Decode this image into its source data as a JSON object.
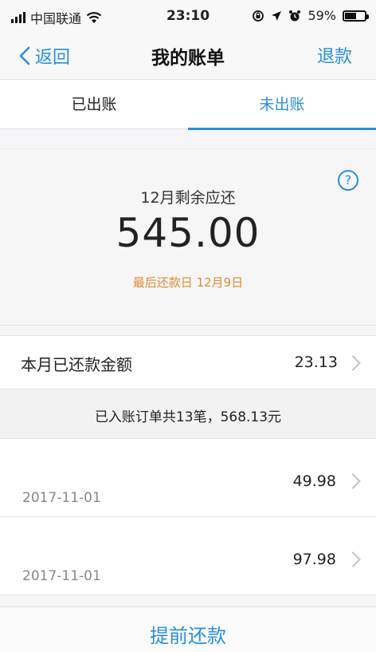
{
  "status_bar": {
    "carrier": "中国联通",
    "time": "23:10",
    "battery": "59%",
    "battery_level": 0.59,
    "icons": [
      "signal-icon",
      "wifi-icon",
      "rotation-lock-icon",
      "location-icon",
      "alarm-icon",
      "battery-icon"
    ]
  },
  "nav": {
    "back_label": "返回",
    "title": "我的账单",
    "right_label": "退款"
  },
  "tabs": [
    {
      "label": "已出账",
      "active": false
    },
    {
      "label": "未出账",
      "active": true
    }
  ],
  "summary": {
    "label": "12月剩余应还",
    "amount": "545.00",
    "due": "最后还款日 12月9日",
    "help_symbol": "?"
  },
  "repaid": {
    "label": "本月已还款金额",
    "value": "23.13"
  },
  "posted_summary": "已入账订单共13笔，568.13元",
  "bills": [
    {
      "amount": "49.98",
      "date": "2017-11-01"
    },
    {
      "amount": "97.98",
      "date": "2017-11-01"
    }
  ],
  "footer": {
    "button_label": "提前还款"
  },
  "colors": {
    "accent": "#2a8ed8",
    "due_text": "#e08a32"
  }
}
